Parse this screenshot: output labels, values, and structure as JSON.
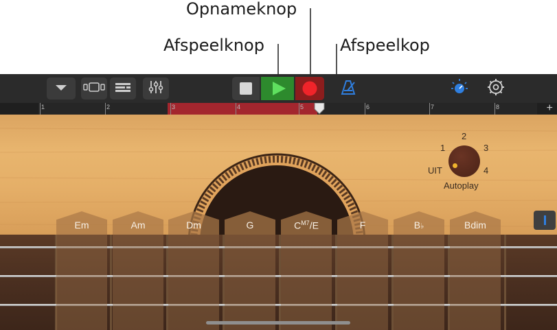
{
  "callouts": {
    "record_button": "Opnameknop",
    "play_button": "Afspeelknop",
    "playhead": "Afspeelkop"
  },
  "ruler": {
    "bars": [
      "1",
      "2",
      "3",
      "4",
      "5",
      "6",
      "7",
      "8"
    ],
    "add_label": "+"
  },
  "chords": {
    "items": [
      "Em",
      "Am",
      "Dm",
      "G",
      "F",
      "Bdim"
    ],
    "cm7e": {
      "root": "C",
      "sup": "M7",
      "bass": "/E"
    },
    "bflat": {
      "root": "B",
      "flat": "♭"
    }
  },
  "autoplay": {
    "label": "Autoplay",
    "positions": [
      "UIT",
      "1",
      "2",
      "3",
      "4"
    ],
    "selected": "UIT"
  },
  "colors": {
    "accent_blue": "#2f7fe0",
    "play_green": "#2d8a2d",
    "record_red": "#e32323",
    "cycle_region": "#a3262e"
  },
  "icons": {
    "track_menu": "chevron-down-icon",
    "browser": "browser-icon",
    "tracks_view": "tracks-view-icon",
    "mixer": "mixer-sliders-icon",
    "stop": "stop-icon",
    "play": "play-icon",
    "record": "record-icon",
    "metronome": "metronome-icon",
    "master_volume": "volume-knob-icon",
    "settings": "gear-icon",
    "chord_strips": "chord-strips-icon"
  }
}
